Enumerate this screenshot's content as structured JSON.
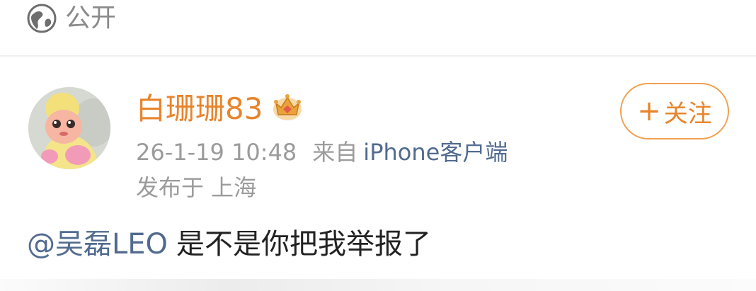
{
  "header": {
    "visibility_label": "公开",
    "visibility_icon": "globe-icon"
  },
  "post": {
    "author": {
      "name": "白珊珊83",
      "badge_icon": "crown-icon"
    },
    "follow_button_label": "关注",
    "timestamp": "26-1-19 10:48",
    "source_prefix": "来自",
    "source_client": "iPhone客户端",
    "location": "发布于 上海",
    "mention": "@吴磊LEO",
    "text": "是不是你把我举报了"
  },
  "colors": {
    "accent_orange": "#e8842c",
    "link_blue": "#526b8f",
    "meta_gray": "#9b9b9b"
  }
}
